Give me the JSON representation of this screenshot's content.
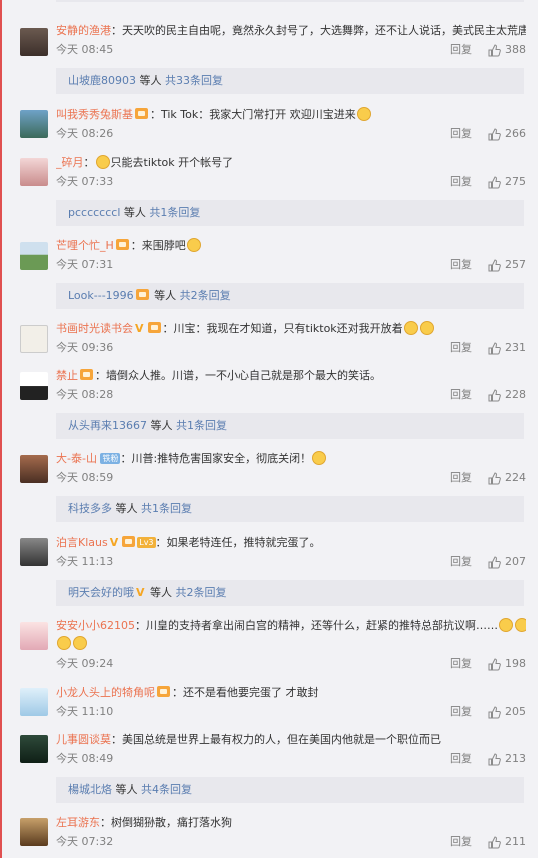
{
  "ui": {
    "reply_label": "回复"
  },
  "comments": [
    {
      "user": "安静的渔港",
      "text": "：天天吹的民主自由呢，竟然永久封号了，大选舞弊，还不让人说话，美式民主太荒唐",
      "time": "今天 08:45",
      "likes": "388"
    },
    {
      "user": "叫我秀秀兔斯基",
      "text": "：Tik Tok：我家大门常打开 欢迎川宝进来",
      "time": "今天 08:26",
      "likes": "266"
    },
    {
      "user": "_碎月",
      "text": "只能去tiktok 开个帐号了",
      "time": "今天 07:33",
      "likes": "275"
    },
    {
      "user": "芒哩个忙_H",
      "text": "：来围脖吧",
      "time": "今天 07:31",
      "likes": "257"
    },
    {
      "user": "书画时光读书会",
      "text": "：川宝：我现在才知道，只有tiktok还对我开放着",
      "time": "今天 09:36",
      "likes": "231"
    },
    {
      "user": "禁止",
      "text": "：墙倒众人推。川谱，一不小心自己就是那个最大的笑话。",
      "time": "今天 08:28",
      "likes": "228"
    },
    {
      "user": "大-泰-山",
      "tag": "铁粉",
      "text": "：川普:推特危害国家安全，彻底关闭！",
      "time": "今天 08:59",
      "likes": "224"
    },
    {
      "user": "泊言Klaus",
      "tag": "Lv3",
      "text": "：如果老特连任，推特就完蛋了。",
      "time": "今天 11:13",
      "likes": "207"
    },
    {
      "user": "安安小小62105",
      "text": "：川皇的支持者拿出闹白宫的精神，还等什么，赶紧的推特总部抗议啊……",
      "time": "今天 09:24",
      "likes": "198"
    },
    {
      "user": "小龙人头上的犄角呢",
      "text": "：还不是看他要完蛋了 才敢封",
      "time": "今天 11:10",
      "likes": "205"
    },
    {
      "user": "儿事圆谈莫",
      "text": "：美国总统是世界上最有权力的人，但在美国内他就是一个职位而已",
      "time": "今天 08:49",
      "likes": "213"
    },
    {
      "user": "左耳游东",
      "text": "：树倒猢狲散，痛打落水狗",
      "time": "今天 07:32",
      "likes": "211"
    }
  ],
  "subs": [
    {
      "user": "山坡鹿80903",
      "etc": " 等人 ",
      "count": "共33条回复"
    },
    {
      "user": "pcccccccl",
      "etc": " 等人 ",
      "count": "共1条回复"
    },
    {
      "user": "Look---1996",
      "etc": " 等人 ",
      "count": "共2条回复"
    },
    {
      "user": "从头再来13667",
      "etc": " 等人 ",
      "count": "共1条回复"
    },
    {
      "user": "科技多多",
      "etc": " 等人 ",
      "count": "共1条回复"
    },
    {
      "user": "明天会好的哦",
      "etc": " 等人 ",
      "count": "共2条回复"
    },
    {
      "user": "楊城北烙",
      "etc": " 等人 ",
      "count": "共4条回复"
    }
  ],
  "colors": {
    "username": "#eb7350",
    "link": "#5a7db0",
    "meta": "#808080",
    "panel": "#f2f2f5",
    "subpanel": "#e8e8ed"
  },
  "icons": [
    "avatar",
    "like-icon",
    "emoji-icon",
    "vip-badge-icon",
    "verified-v-icon"
  ]
}
